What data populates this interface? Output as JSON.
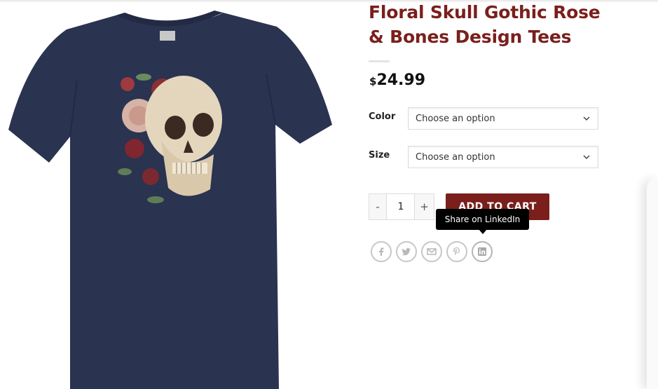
{
  "product": {
    "title": "Floral Skull Gothic Rose & Bones Design Tees",
    "price_currency": "$",
    "price_amount": "24.99",
    "image_alt": "Navy t-shirt with floral skull print"
  },
  "variations": {
    "color_label": "Color",
    "color_value": "Choose an option",
    "size_label": "Size",
    "size_value": "Choose an option"
  },
  "cart": {
    "minus_label": "-",
    "quantity": "1",
    "plus_label": "+",
    "add_to_cart_label": "ADD TO CART"
  },
  "share": {
    "tooltip": "Share on LinkedIn",
    "icons": [
      "facebook-icon",
      "twitter-icon",
      "email-icon",
      "pinterest-icon",
      "linkedin-icon"
    ]
  },
  "colors": {
    "brand": "#7a1f1c",
    "shirt": "#2a3350"
  }
}
